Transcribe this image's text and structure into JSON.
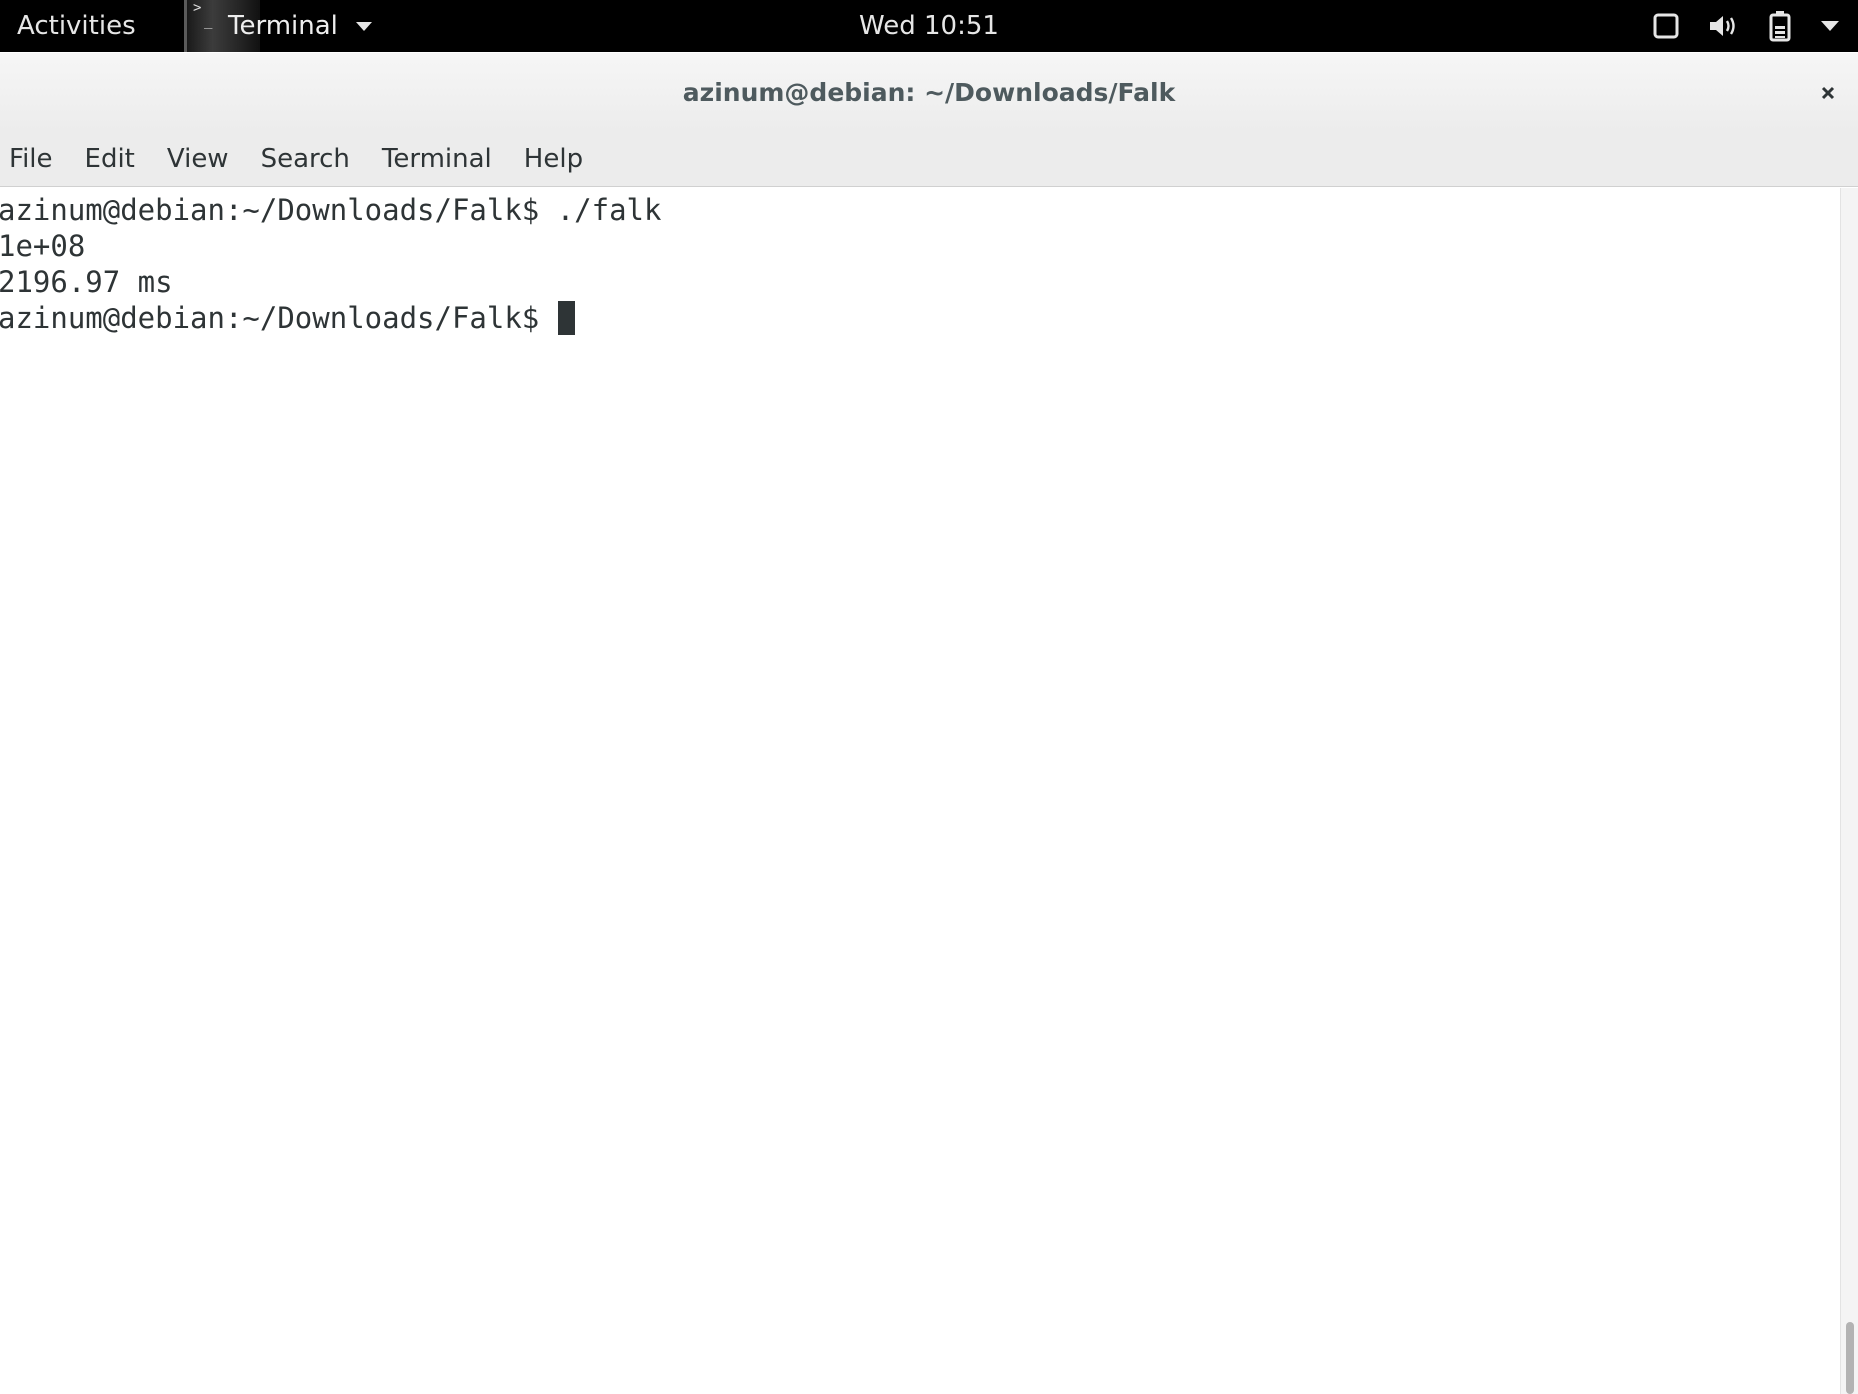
{
  "topbar": {
    "activities_label": "Activities",
    "app_name": "Terminal",
    "clock": "Wed 10:51",
    "tray_icons": [
      "window-icon",
      "volume-icon",
      "battery-icon",
      "system-menu-caret-icon"
    ]
  },
  "window": {
    "title": "azinum@debian: ~/Downloads/Falk",
    "close_label": "×"
  },
  "menu": {
    "items": [
      "File",
      "Edit",
      "View",
      "Search",
      "Terminal",
      "Help"
    ]
  },
  "terminal": {
    "lines": [
      "azinum@debian:~/Downloads/Falk$ ./falk",
      "1e+08",
      "2196.97 ms",
      "azinum@debian:~/Downloads/Falk$ "
    ]
  },
  "colors": {
    "topbar_bg": "#000000",
    "titlebar_bg": "#ececec",
    "terminal_fg": "#2e3436",
    "terminal_bg": "#ffffff"
  }
}
